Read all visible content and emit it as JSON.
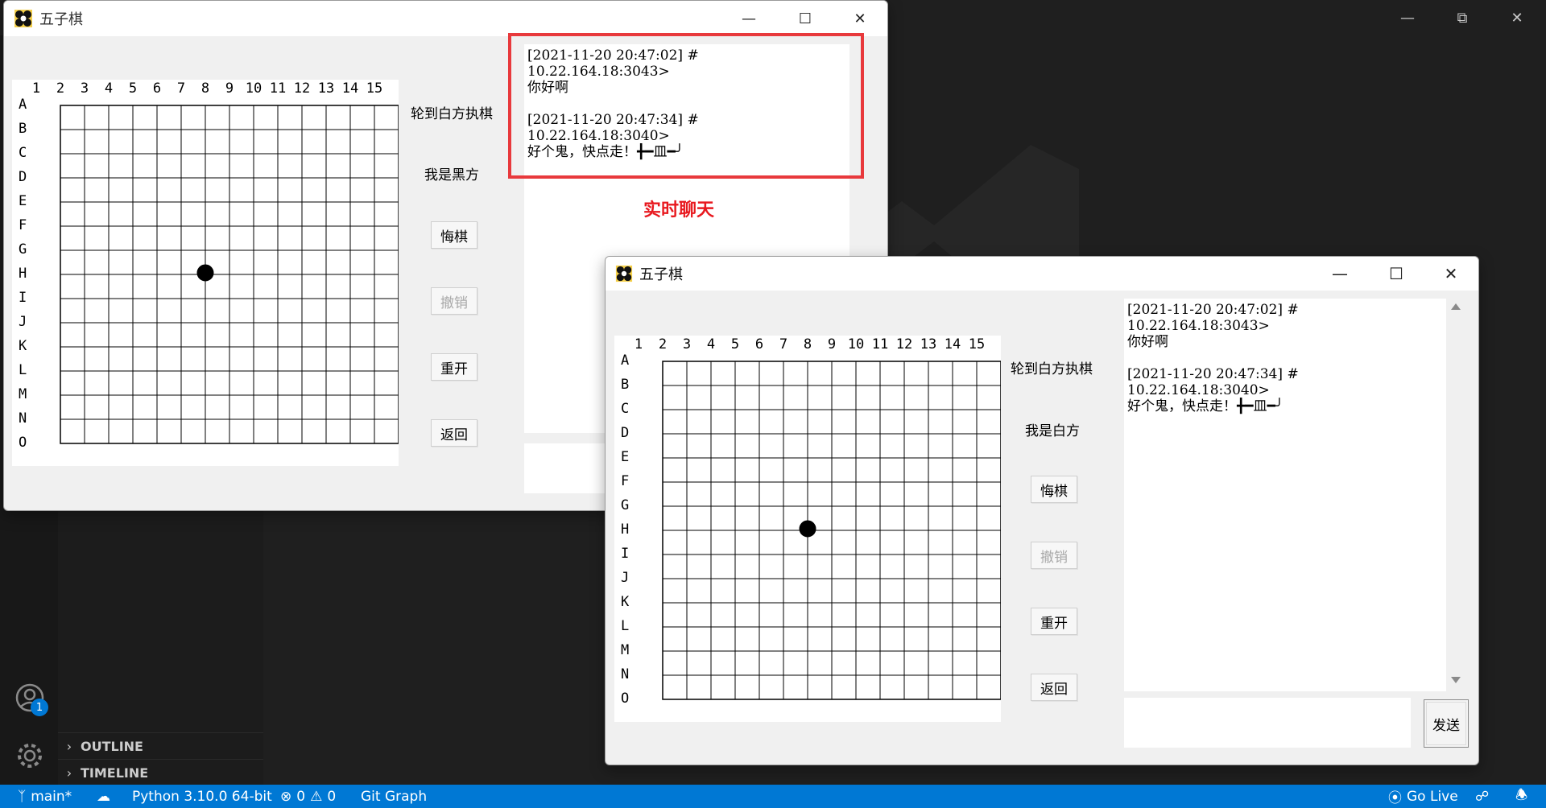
{
  "app_title": "五子棋",
  "column_labels": [
    "1",
    "2",
    "3",
    "4",
    "5",
    "6",
    "7",
    "8",
    "9",
    "10",
    "11",
    "12",
    "13",
    "14",
    "15"
  ],
  "row_labels": [
    "A",
    "B",
    "C",
    "D",
    "E",
    "F",
    "G",
    "H",
    "I",
    "J",
    "K",
    "L",
    "M",
    "N",
    "O"
  ],
  "stones": [
    {
      "row": "H",
      "col": 8,
      "color": "black"
    }
  ],
  "window_back": {
    "turn_text": "轮到白方执棋",
    "role_text": "我是黑方",
    "buttons": {
      "regret": "悔棋",
      "undo": "撤销",
      "restart": "重开",
      "back": "返回"
    },
    "chat_lines": [
      "[2021-11-20 20:47:02] #",
      "10.22.164.18:3043>",
      "你好啊",
      "",
      "[2021-11-20 20:47:34] #",
      "10.22.164.18:3040>",
      "好个鬼，快点走！╋━皿━╯"
    ],
    "annotation_label": "实时聊天"
  },
  "window_front": {
    "turn_text": "轮到白方执棋",
    "role_text": "我是白方",
    "buttons": {
      "regret": "悔棋",
      "undo": "撤销",
      "restart": "重开",
      "back": "返回",
      "send": "发送"
    },
    "chat_lines": [
      "[2021-11-20 20:47:02] #",
      "10.22.164.18:3043>",
      "你好啊",
      "",
      "[2021-11-20 20:47:34] #",
      "10.22.164.18:3040>",
      "好个鬼，快点走！╋━皿━╯"
    ]
  },
  "vscode": {
    "sections": {
      "outline": "OUTLINE",
      "timeline": "TIMELINE"
    },
    "account_badge": "1",
    "statusbar": {
      "branch": "main*",
      "python": "Python 3.10.0 64-bit",
      "errors": "0",
      "warnings": "0",
      "git_graph": "Git Graph",
      "go_live": "Go Live"
    },
    "accent_color": "#0078d4"
  }
}
